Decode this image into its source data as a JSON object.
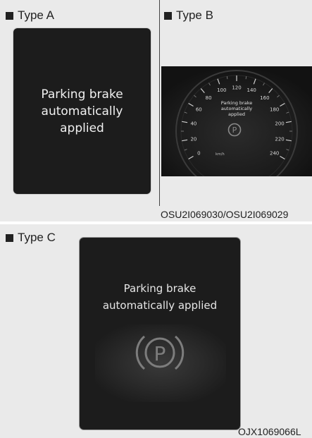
{
  "type_a": {
    "label": "Type A",
    "message_line1": "Parking brake",
    "message_line2": "automatically",
    "message_line3": "applied"
  },
  "type_b": {
    "label": "Type B",
    "message_line1": "Parking brake",
    "message_line2": "automatically",
    "message_line3": "applied",
    "speed_ticks": [
      "0",
      "20",
      "40",
      "60",
      "80",
      "100",
      "120",
      "140",
      "160",
      "180",
      "200",
      "220",
      "240"
    ],
    "speed_unit": "km/h",
    "brake_icon": "parking-brake-icon"
  },
  "top_caption": "OSU2I069030/OSU2I069029",
  "type_c": {
    "label": "Type C",
    "message_line1": "Parking brake",
    "message_line2": "automatically applied",
    "brake_icon": "parking-brake-icon"
  },
  "bottom_caption": "OJX1069066L",
  "colors": {
    "panel_background": "#eaeaea",
    "screen_background": "#1c1c1c",
    "screen_text": "#f0f0f0"
  }
}
